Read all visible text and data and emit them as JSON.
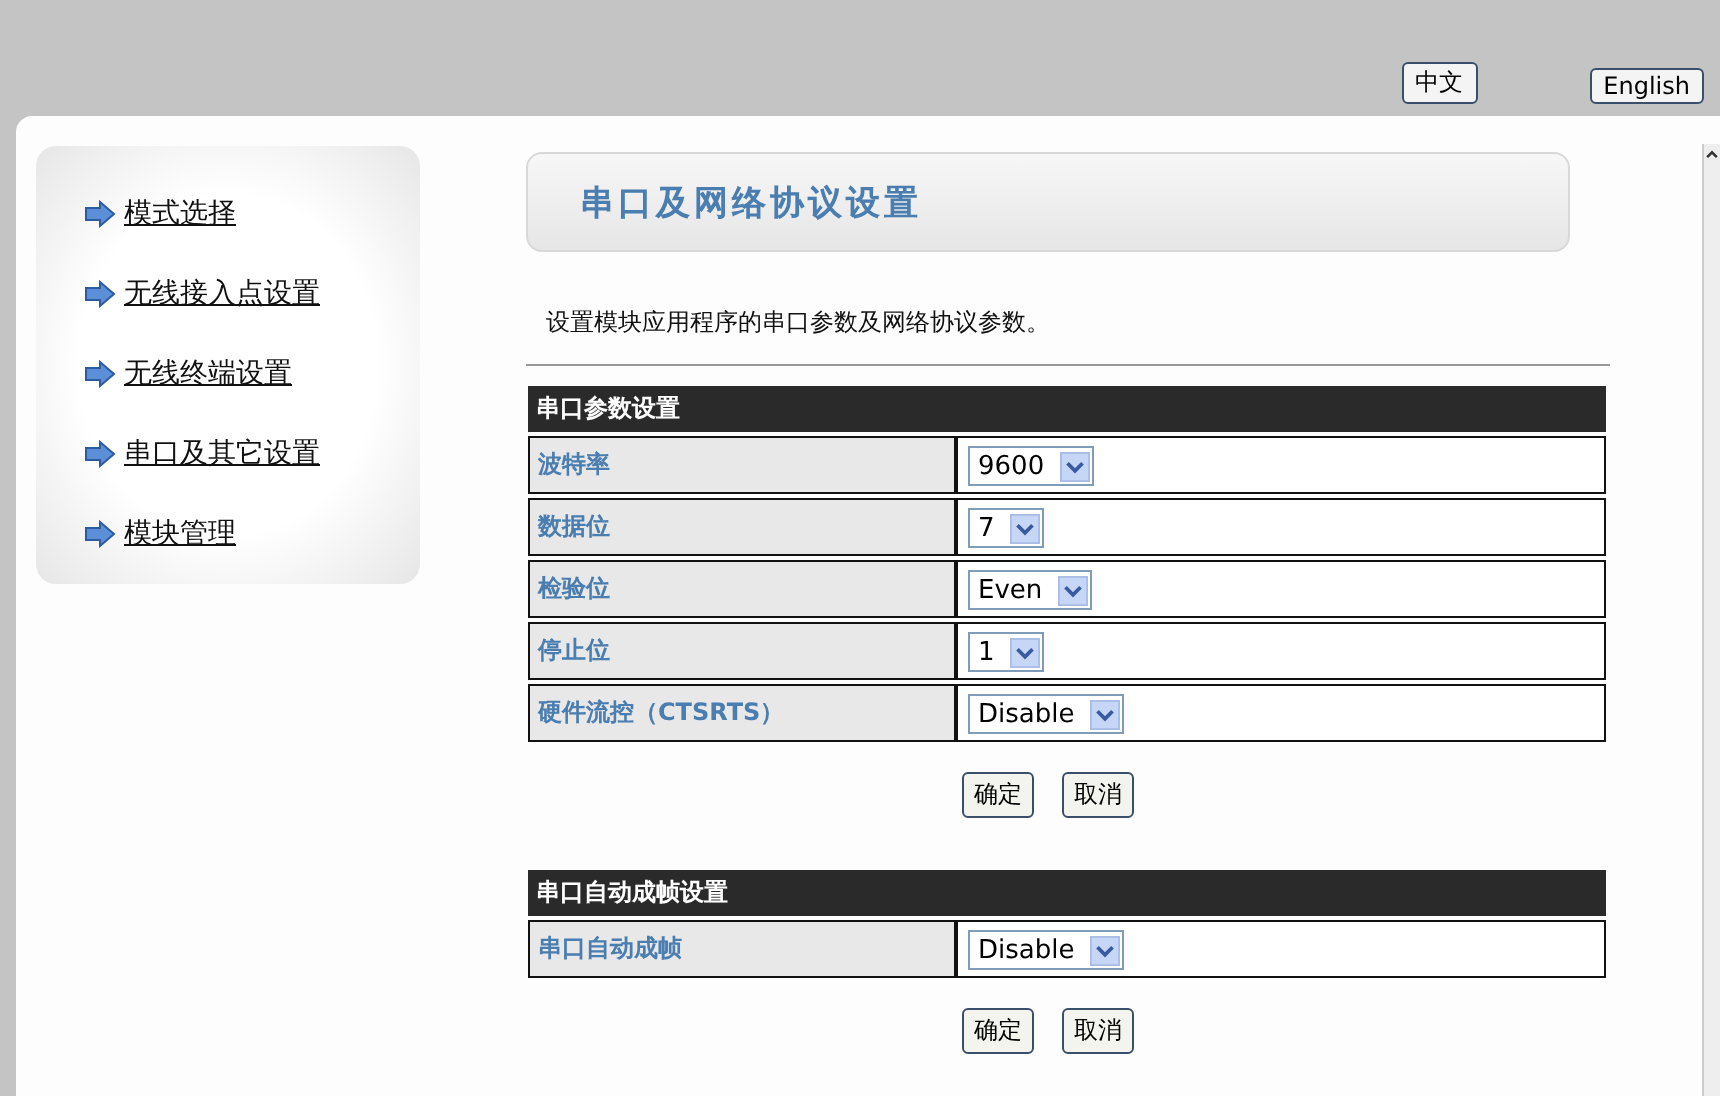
{
  "languages": [
    "中文",
    "English"
  ],
  "sidebar": {
    "items": [
      {
        "label": "模式选择"
      },
      {
        "label": "无线接入点设置"
      },
      {
        "label": "无线终端设置"
      },
      {
        "label": "串口及其它设置"
      },
      {
        "label": "模块管理"
      }
    ]
  },
  "page_title": "串口及网络协议设置",
  "description": "设置模块应用程序的串口参数及网络协议参数。",
  "sections": [
    {
      "title": "串口参数设置",
      "rows": [
        {
          "label": "波特率",
          "value": "9600"
        },
        {
          "label": "数据位",
          "value": "7"
        },
        {
          "label": "检验位",
          "value": "Even"
        },
        {
          "label": "停止位",
          "value": "1"
        },
        {
          "label": "硬件流控（CTSRTS）",
          "value": "Disable"
        }
      ],
      "buttons": [
        "确定",
        "取消"
      ]
    },
    {
      "title": "串口自动成帧设置",
      "rows": [
        {
          "label": "串口自动成帧",
          "value": "Disable"
        }
      ],
      "buttons": [
        "确定",
        "取消"
      ]
    }
  ]
}
